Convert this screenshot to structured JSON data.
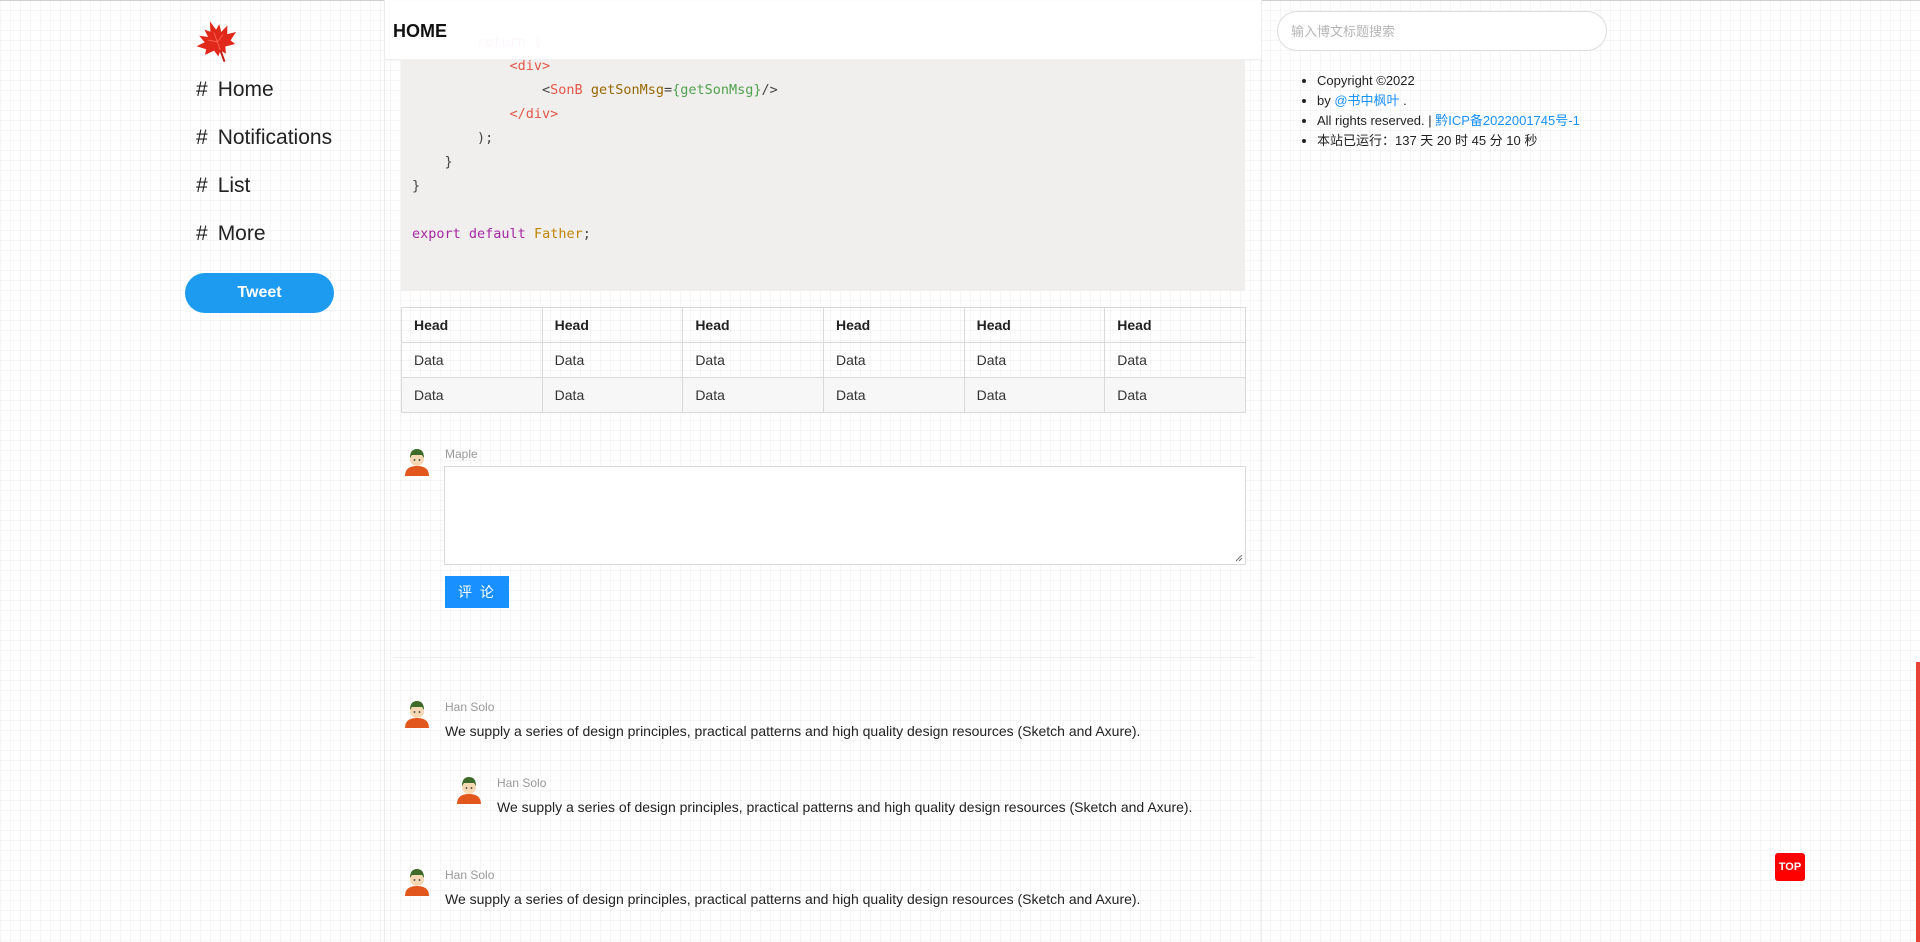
{
  "sidebar": {
    "logo_icon": "maple-leaf-icon",
    "nav": [
      {
        "hash": "#",
        "label": "Home"
      },
      {
        "hash": "#",
        "label": "Notifications"
      },
      {
        "hash": "#",
        "label": "List"
      },
      {
        "hash": "#",
        "label": "More"
      }
    ],
    "tweet_label": "Tweet"
  },
  "header": {
    "title": "HOME"
  },
  "code_block": {
    "lines": [
      "        return (",
      "            <div>",
      "                <SonB getSonMsg={getSonMsg}/>",
      "            </div>",
      "        );",
      "    }",
      "}",
      "",
      "export default Father;"
    ]
  },
  "table": {
    "headers": [
      "Head",
      "Head",
      "Head",
      "Head",
      "Head",
      "Head"
    ],
    "rows": [
      [
        "Data",
        "Data",
        "Data",
        "Data",
        "Data",
        "Data"
      ],
      [
        "Data",
        "Data",
        "Data",
        "Data",
        "Data",
        "Data"
      ]
    ]
  },
  "comment_editor": {
    "author": "Maple",
    "placeholder": "",
    "submit_label": "评 论"
  },
  "comments": [
    {
      "author": "Han Solo",
      "text": "We supply a series of design principles, practical patterns and high quality design resources (Sketch and Axure)."
    },
    {
      "author": "Han Solo",
      "text": "We supply a series of design principles, practical patterns and high quality design resources (Sketch and Axure)."
    },
    {
      "author": "Han Solo",
      "text": "We supply a series of design principles, practical patterns and high quality design resources (Sketch and Axure)."
    }
  ],
  "right": {
    "search_placeholder": "输入博文标题搜索",
    "copyright": "Copyright ©2022",
    "by_prefix": "by ",
    "by_link": "@书中枫叶",
    "by_suffix": " .",
    "rights_prefix": "All rights reserved. | ",
    "icp_link": "黔ICP备2022001745号-1",
    "uptime": "本站已运行：137 天 20 时 45 分 10 秒"
  },
  "top_button_label": "TOP",
  "colors": {
    "accent": "#1890ff",
    "tweet": "#1d9bf0",
    "top_button": "#ff0000",
    "code_bg": "#f0efed"
  }
}
